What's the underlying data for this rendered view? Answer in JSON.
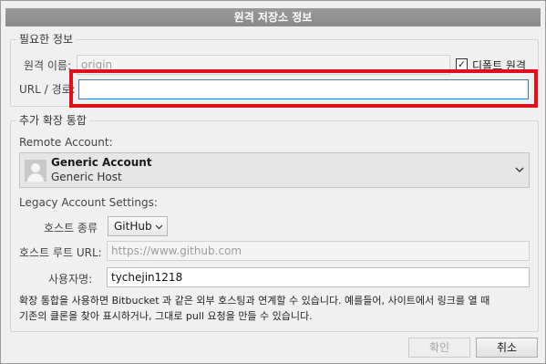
{
  "dialog": {
    "title": "원격 저장소 정보"
  },
  "required": {
    "legend": "필요한 정보",
    "remote_name_label": "원격 이름:",
    "remote_name_value": "origin",
    "default_remote_label": "디폴트 원격",
    "default_remote_checked": "✓",
    "url_label": "URL / 경로:",
    "url_value": ""
  },
  "integration": {
    "legend": "추가 확장 통합",
    "remote_account_label": "Remote Account:",
    "account_name": "Generic Account",
    "account_host": "Generic Host",
    "legacy_label": "Legacy Account Settings:",
    "host_type_label": "호스트 종류",
    "host_type_value": "GitHub",
    "host_root_label": "호스트 루트 URL:",
    "host_root_placeholder": "https://www.github.com",
    "username_label": "사용자명:",
    "username_value": "tychejin1218",
    "info_line1": "확장 통합을 사용하면 Bitbucket 과 같은 외부 호스팅과 연계할 수 있습니다. 예를들어, 사이트에서 링크를 열 때",
    "info_line2": "기존의 클론을 찾아 표시하거나, 그대로 pull 요청을 만들 수 있습니다."
  },
  "buttons": {
    "ok": "확인",
    "cancel": "취소"
  },
  "colors": {
    "highlight": "#e0101a",
    "titlebar": "#8f8f8f",
    "focus": "#3a78c8"
  },
  "icons": {
    "avatar": "user-avatar-icon",
    "account_dropdown": "chevron-down-icon",
    "host_dropdown": "chevron-down-icon"
  }
}
